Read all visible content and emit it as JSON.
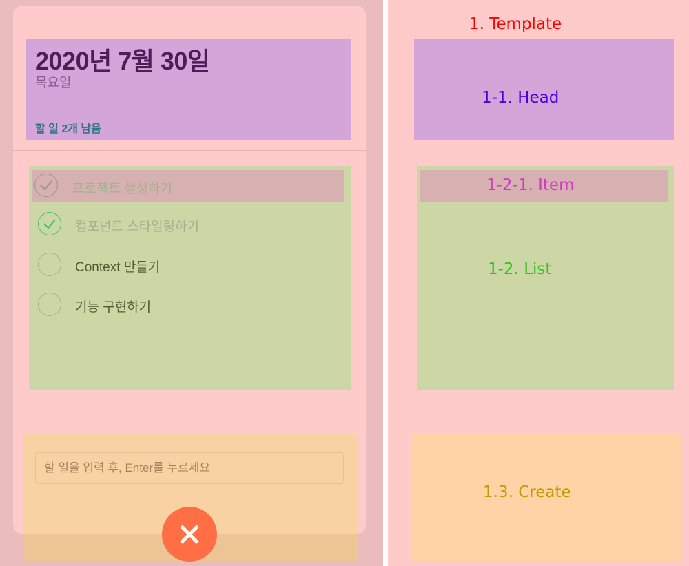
{
  "mockup": {
    "head": {
      "date": "2020년 7월 30일",
      "day": "목요일",
      "tasks_left": "할 일 2개 남음"
    },
    "items": [
      {
        "text": "프로젝트 생성하기",
        "done": true
      },
      {
        "text": "컴포넌트 스타일링하기",
        "done": true
      },
      {
        "text": "Context 만들기",
        "done": false
      },
      {
        "text": "기능 구현하기",
        "done": false
      }
    ],
    "create": {
      "placeholder": "할 일을 입력 후, Enter를 누르세요",
      "fab_icon": "close-icon"
    }
  },
  "diagram": {
    "template_label": "1. Template",
    "head_label": "1-1. Head",
    "item_label": "1-2-1. Item",
    "list_label": "1-2. List",
    "create_label": "1.3. Create"
  },
  "colors": {
    "template": "#ffcaca",
    "head": "#d3a5d8",
    "list": "#cdd7a5",
    "item": "#d7b0b1",
    "create": "#fed3a5",
    "fab": "#ff6e45",
    "check_green": "#3bc26b",
    "label_template": "#ff0000",
    "label_head": "#4b00e0",
    "label_item": "#d13ac6",
    "label_list": "#2fc41a",
    "label_create": "#c49a00"
  }
}
